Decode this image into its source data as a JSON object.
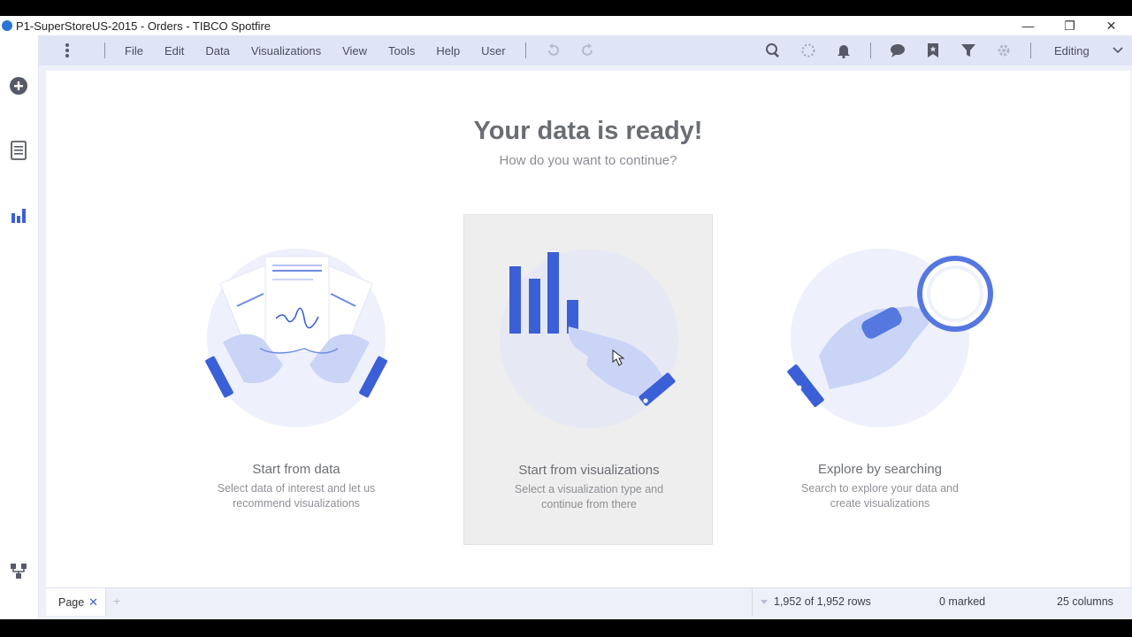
{
  "window": {
    "title": "P1-SuperStoreUS-2015 - Orders - TIBCO Spotfire",
    "minimize": "—",
    "restore": "❐",
    "close": "✕"
  },
  "menu": {
    "items": [
      "File",
      "Edit",
      "Data",
      "Visualizations",
      "View",
      "Tools",
      "Help",
      "User"
    ],
    "mode_label": "Editing"
  },
  "main": {
    "headline": "Your data is ready!",
    "subline": "How do you want to continue?",
    "options": [
      {
        "title": "Start from data",
        "desc_line1": "Select data of interest and let us",
        "desc_line2": "recommend visualizations"
      },
      {
        "title": "Start from visualizations",
        "desc_line1": "Select a visualization type and",
        "desc_line2": "continue from there"
      },
      {
        "title": "Explore by searching",
        "desc_line1": "Search to explore your data and",
        "desc_line2": "create visualizations"
      }
    ]
  },
  "bottom": {
    "page_tab": "Page",
    "tab_close": "✕",
    "add_page": "+",
    "rows": "1,952 of 1,952 rows",
    "marked": "0 marked",
    "columns": "25 columns"
  },
  "colors": {
    "accent": "#3b5fd6",
    "menubar_bg": "#dfe4f7",
    "illustration_light": "#c9d4f7"
  }
}
